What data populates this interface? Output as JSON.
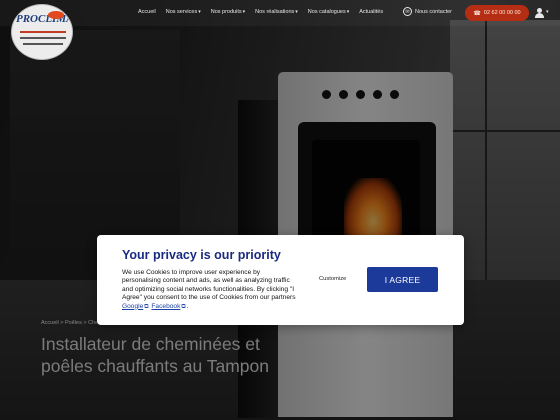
{
  "header": {
    "logo_alt": "PROCLIMA",
    "nav": [
      {
        "label": "Accueil",
        "has_dropdown": false
      },
      {
        "label": "Nos services",
        "has_dropdown": true
      },
      {
        "label": "Nos produits",
        "has_dropdown": true
      },
      {
        "label": "Nos réalisations",
        "has_dropdown": true
      },
      {
        "label": "Nos catalogues",
        "has_dropdown": true
      },
      {
        "label": "Actualités",
        "has_dropdown": false
      }
    ],
    "contact_label": "Nous contacter",
    "phone_label": "02 62 00 00 00",
    "dropdown_caret": "▾"
  },
  "hero": {
    "breadcrumb": "Accueil > Poêles > Cheminées > Tampon",
    "title": "Installateur de cheminées et poêles chauffants au Tampon"
  },
  "privacy": {
    "title": "Your privacy is our priority",
    "text_before": "We use Cookies to improve user experience by personalising content and ads, as well as analyzing traffic and optimizing social networks functionalities. By clicking \"I Agree\" you consent to the use of Cookies from our partners ",
    "google_link": "Google",
    "facebook_link": "Facebook",
    "text_end": ".",
    "customize_label": "Customize",
    "agree_label": "I AGREE"
  },
  "colors": {
    "accent": "#1c3a9a",
    "title_blue": "#1a2a80",
    "phone_button": "#b52e13"
  }
}
